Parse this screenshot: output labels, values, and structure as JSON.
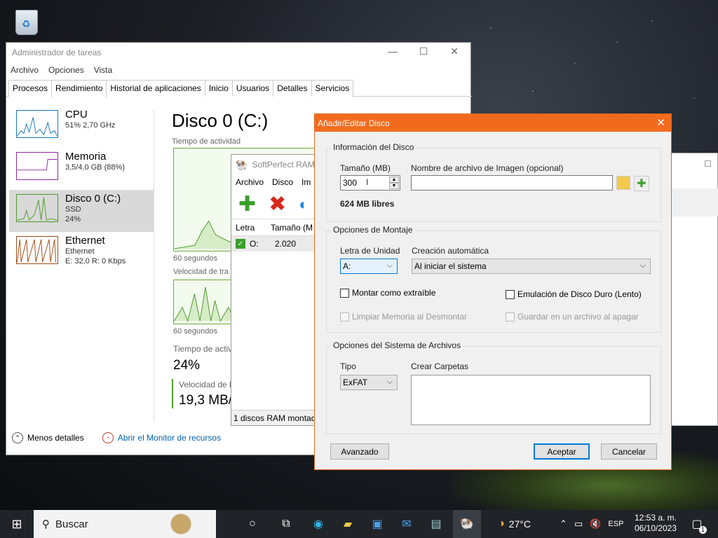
{
  "taskmanager": {
    "title": "Administrador de tareas",
    "menu": [
      "Archivo",
      "Opciones",
      "Vista"
    ],
    "tabs": [
      "Procesos",
      "Rendimiento",
      "Historial de aplicaciones",
      "Inicio",
      "Usuarios",
      "Detalles",
      "Servicios"
    ],
    "active_tab": "Rendimiento",
    "sidebar": [
      {
        "name": "CPU",
        "line1": "51% 2,70 GHz",
        "line2": ""
      },
      {
        "name": "Memoria",
        "line1": "3,5/4,0 GB (88%)",
        "line2": ""
      },
      {
        "name": "Disco 0 (C:)",
        "line1": "SSD",
        "line2": "24%"
      },
      {
        "name": "Ethernet",
        "line1": "Ethernet",
        "line2": "E: 32,0 R: 0 Kbps"
      }
    ],
    "main": {
      "title": "Disco 0 (C:)",
      "activity_label": "Tiempo de actividad",
      "sixty1": "60 segundos",
      "transfer_label": "Velocidad de tra",
      "sixty2": "60 segundos",
      "active_time_label": "Tiempo de activ",
      "active_time_value": "24%",
      "read_speed_label": "Velocidad de l",
      "read_speed_value": "19,3 MB/"
    },
    "footer": {
      "less": "Menos detalles",
      "monitor": "Abrir el Monitor de recursos"
    }
  },
  "softperfect": {
    "title": "SoftPerfect RAM",
    "menu": [
      "Archivo",
      "Disco",
      "Im"
    ],
    "columns": [
      "Letra",
      "Tamaño (M"
    ],
    "row": {
      "letter": "O:",
      "size": "2.020"
    },
    "status": "1 discos RAM montad"
  },
  "dialog": {
    "title": "Añadir/Editar Disco",
    "disk_info_group": "Información del Disco",
    "size_label": "Tamaño (MB)",
    "size_value": "300",
    "image_label": "Nombre de archivo de Imagen (opcional)",
    "image_value": "",
    "free": "624 MB libres",
    "mount_group": "Opciones de Montaje",
    "drive_letter_label": "Letra de Unidad",
    "drive_letter_value": "A:",
    "auto_create_label": "Creación automática",
    "auto_create_value": "Al iniciar el sistema",
    "mount_removable": "Montar como extraíble",
    "hdd_emulation": "Emulación de Disco Duro (Lento)",
    "clear_memory": "Limpiar Memoria al Desmontar",
    "save_shutdown": "Guardar en un archivo al apagar",
    "fs_group": "Opciones del Sistema de Archivos",
    "type_label": "Tipo",
    "type_value": "ExFAT",
    "folders_label": "Crear Carpetas",
    "advanced": "Avanzado",
    "accept": "Aceptar",
    "cancel": "Cancelar"
  },
  "taskbar": {
    "search": "Buscar",
    "weather": "27°C",
    "lang": "ESP",
    "time": "12:53 a. m.",
    "date": "06/10/2023",
    "notif_count": "1"
  }
}
